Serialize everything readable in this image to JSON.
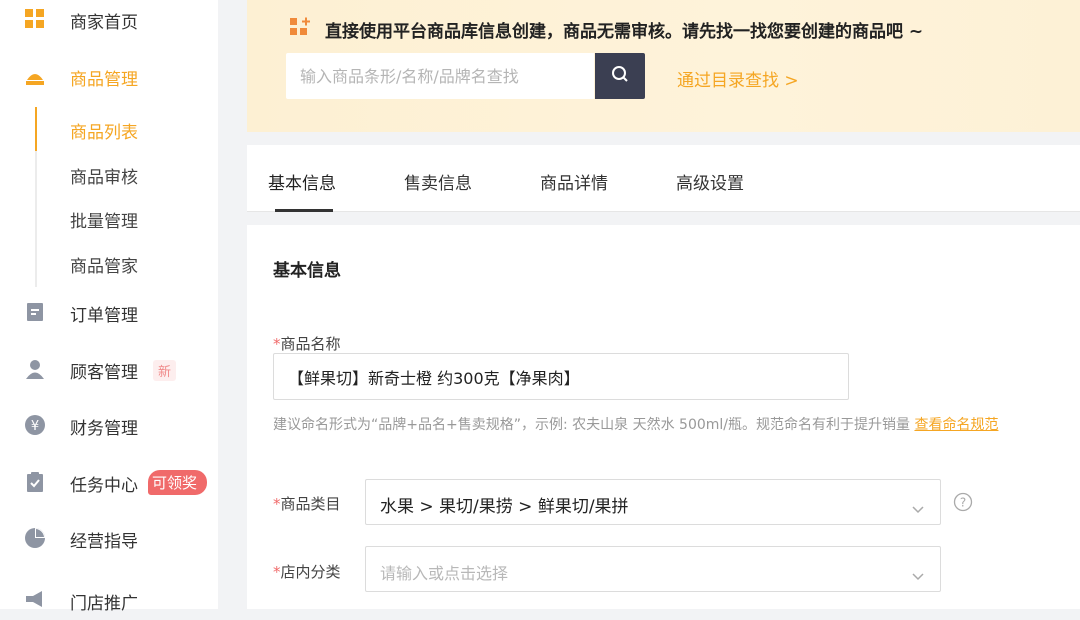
{
  "sidebar": {
    "items": [
      {
        "label": "商家首页",
        "icon": "dashboard-grid-icon"
      },
      {
        "label": "商品管理",
        "icon": "product-box-icon"
      },
      {
        "label": "订单管理",
        "icon": "order-doc-icon"
      },
      {
        "label": "顾客管理",
        "icon": "user-icon",
        "badge": "新"
      },
      {
        "label": "财务管理",
        "icon": "yen-coin-icon"
      },
      {
        "label": "任务中心",
        "icon": "clipboard-check-icon",
        "badge": "可领奖"
      },
      {
        "label": "经营指导",
        "icon": "pie-chart-icon"
      },
      {
        "label": "门店推广",
        "icon": "megaphone-icon"
      }
    ],
    "sub_items": [
      {
        "label": "商品列表"
      },
      {
        "label": "商品审核"
      },
      {
        "label": "批量管理"
      },
      {
        "label": "商品管家"
      }
    ]
  },
  "banner": {
    "text": "直接使用平台商品库信息创建，商品无需审核。请先找一找您要创建的商品吧 ~",
    "search_placeholder": "输入商品条形/名称/品牌名查找",
    "catalog_link": "通过目录查找 >"
  },
  "tabs": [
    {
      "label": "基本信息"
    },
    {
      "label": "售卖信息"
    },
    {
      "label": "商品详情"
    },
    {
      "label": "高级设置"
    }
  ],
  "form": {
    "section_title": "基本信息",
    "required_mark": "*",
    "name_label": "商品名称",
    "name_value": "【鲜果切】新奇士橙 约300克【净果肉】",
    "hint_text": "建议命名形式为“品牌+品名+售卖规格”，示例: 农夫山泉 天然水 500ml/瓶。规范命名有利于提升销量 ",
    "hint_link": "查看命名规范",
    "category_label": "商品类目",
    "category_value": "水果 > 果切/果捞 > 鲜果切/果拼",
    "store_category_label": "店内分类",
    "store_category_placeholder": "请输入或点击选择"
  },
  "colors": {
    "accent": "#f5a623",
    "banner_bg": "#fdf0d3",
    "search_button": "#3b3f52",
    "required": "#f06a6a",
    "badge_red": "#f06a6a"
  }
}
